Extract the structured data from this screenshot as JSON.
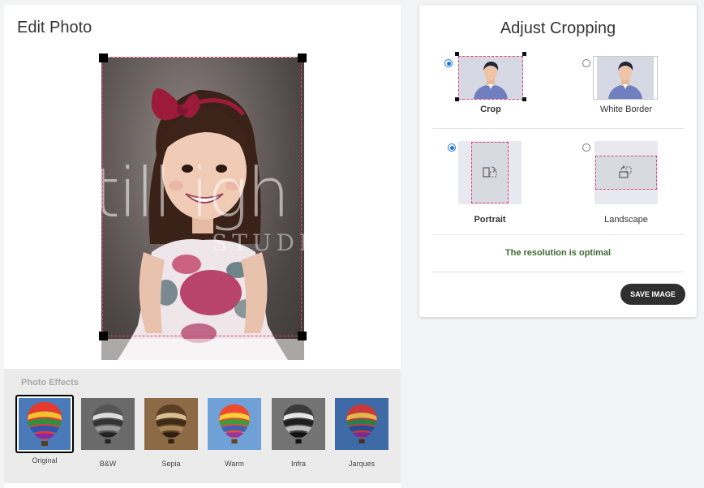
{
  "edit_photo": {
    "title": "Edit Photo",
    "watermark_main": "till igh",
    "watermark_sub": "STUDIO"
  },
  "effects": {
    "title": "Photo Effects",
    "items": [
      {
        "label": "Original",
        "selected": true
      },
      {
        "label": "B&W",
        "selected": false
      },
      {
        "label": "Sepia",
        "selected": false
      },
      {
        "label": "Warm",
        "selected": false
      },
      {
        "label": "Infra",
        "selected": false
      },
      {
        "label": "Jarques",
        "selected": false
      }
    ]
  },
  "adjust_cropping": {
    "title": "Adjust Cropping",
    "fit_options": [
      {
        "label": "Crop",
        "checked": true
      },
      {
        "label": "White Border",
        "checked": false
      }
    ],
    "orientation_options": [
      {
        "label": "Portrait",
        "checked": true
      },
      {
        "label": "Landscape",
        "checked": false
      }
    ],
    "resolution_text": "The resolution is optimal",
    "save_label": "SAVE IMAGE"
  },
  "colors": {
    "accent_pink": "#e0407a",
    "radio_blue": "#1a73e8",
    "resolution_green": "#3b6b2e",
    "button_dark": "#2f2f2f"
  }
}
